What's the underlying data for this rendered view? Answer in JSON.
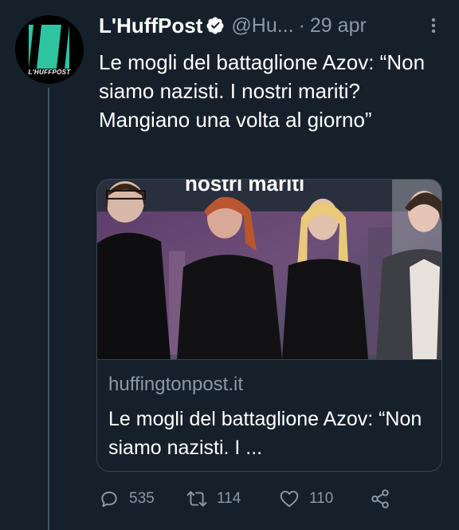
{
  "tweet": {
    "author": {
      "name": "L'HuffPost",
      "handle": "@Hu...",
      "avatar_text": "L'HUFFPOST",
      "avatar_accent": "#2ec4a0",
      "verified_icon": "verified-badge-icon"
    },
    "separator": "·",
    "date": "29 apr",
    "text": "Le mogli del battaglione Azov: “Non siamo nazisti. I nostri mariti? Mangiano una volta al giorno”",
    "card": {
      "image_overlay_text": "nostri mariti",
      "domain": "huffingtonpost.it",
      "title": "Le mogli del battaglione Azov: “Non siamo nazisti. I ..."
    },
    "actions": {
      "reply_count": "535",
      "retweet_count": "114",
      "like_count": "110"
    }
  },
  "colors": {
    "background": "#15202b",
    "secondary_text": "#8b98a5",
    "border": "#38444d",
    "verified": "#ffffff"
  }
}
